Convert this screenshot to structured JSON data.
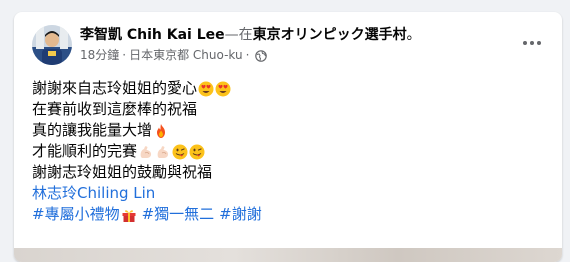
{
  "post": {
    "author": "李智凱 Chih Kai Lee",
    "separator": "—在",
    "place": "東京オリンピック選手村",
    "place_suffix": "。",
    "time": "18分鐘",
    "dot": "·",
    "location": "日本東京都 Chuo-ku",
    "dot2": "·",
    "privacy_icon": "globe-icon",
    "more_icon": "more-options-icon"
  },
  "content": {
    "line1": "謝謝來自志玲姐姐的愛心",
    "line2": "在賽前收到這麼棒的祝福",
    "line3": "真的讓我能量大增",
    "line4": "才能順利的完賽",
    "line5": "謝謝志玲姐姐的鼓勵與祝福",
    "mention": "林志玲Chiling Lin",
    "hashtag1": "#專屬小禮物",
    "hashtag2": "#獨一無二",
    "hashtag3": "#謝謝"
  },
  "colors": {
    "link": "#216fdb",
    "text": "#050505",
    "secondary": "#65676b",
    "background": "#f0f2f5"
  }
}
